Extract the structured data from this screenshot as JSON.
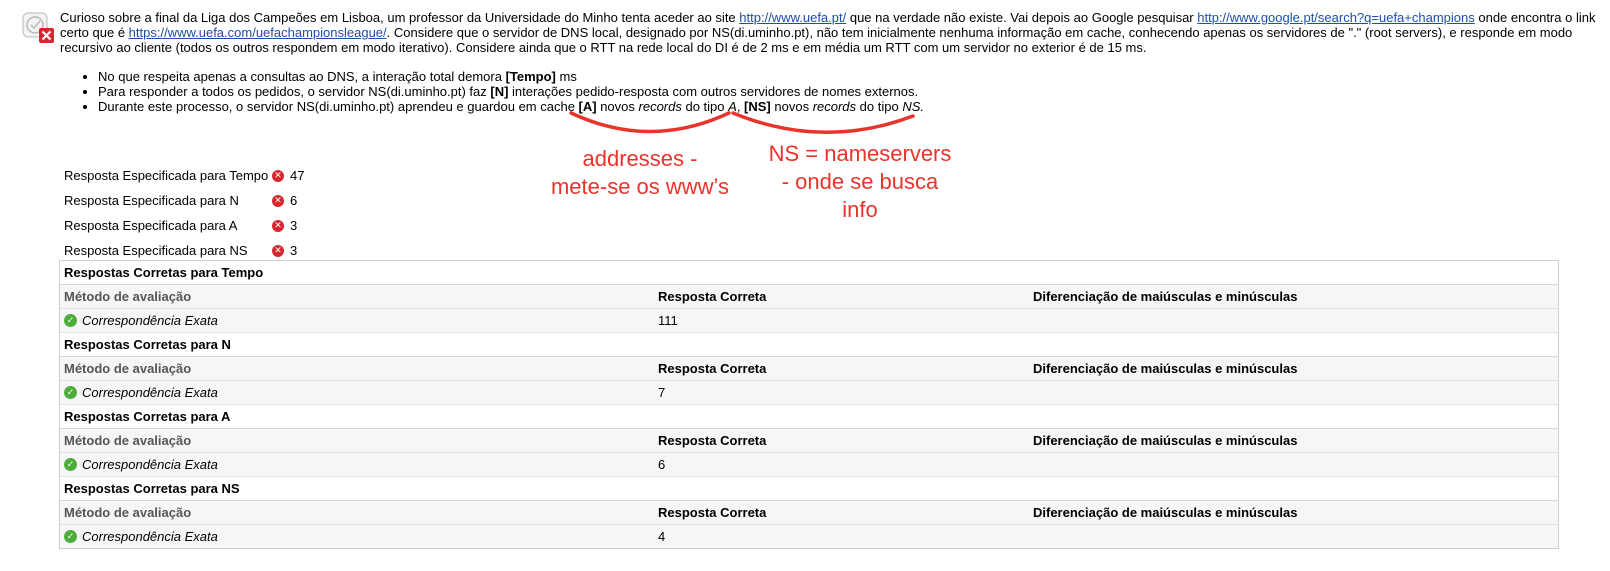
{
  "question": {
    "icon": "question-status-icon",
    "intro_1": "Curioso sobre a final da Liga dos Campeões em Lisboa, um professor da Universidade do Minho tenta aceder ao site ",
    "link_1": "http://www.uefa.pt/",
    "intro_2": " que na verdade não existe. Vai depois ao Google pesquisar ",
    "link_2": "http://www.google.pt/search?q=uefa+champions",
    "intro_3": " onde encontra o link certo que é ",
    "link_3": "https://www.uefa.com/uefachampionsleague/",
    "intro_4": ".  Considere que o servidor de DNS local, designado por NS(di.uminho.pt), não tem inicialmente nenhuma informação em cache, conhecendo apenas os servidores de \".\" (root servers), e responde em modo recursivo ao cliente (todos os outros respondem em modo iterativo). Considere ainda que o RTT na rede local do DI é de 2 ms e em média um RTT com um servidor no exterior é de 15 ms.",
    "b1_pre": "No que respeita apenas a consultas ao DNS, a interação total demora ",
    "b1_tag": "[Tempo]",
    "b1_post": " ms",
    "b2_pre": "Para responder a todos os pedidos, o servidor NS(di.uminho.pt) faz ",
    "b2_tag": "[N]",
    "b2_post": " interações pedido-resposta com outros servidores de nomes externos.",
    "b3_pre": "Durante este processo, o servidor NS(di.uminho.pt) aprendeu e guardou em cache ",
    "b3_tagA": "[A]",
    "b3_mid1": " novos ",
    "b3_rec1": "records",
    "b3_mid2": " do tipo ",
    "b3_typeA": "A",
    "b3_comma": ", ",
    "b3_tagNS": "[NS]",
    "b3_mid3": " novos ",
    "b3_rec2": "records",
    "b3_mid4": " do tipo ",
    "b3_typeNS": "NS."
  },
  "specified": [
    {
      "label": "Resposta Especificada para Tempo",
      "value": "47"
    },
    {
      "label": "Resposta Especificada para N",
      "value": "6"
    },
    {
      "label": "Resposta Especificada para A",
      "value": "3"
    },
    {
      "label": "Resposta Especificada para NS",
      "value": "3"
    }
  ],
  "wrong_mark": "✕",
  "ok_mark": "✓",
  "sections": [
    {
      "title": "Respostas Corretas para Tempo",
      "method": "Correspondência Exata",
      "answer": "111"
    },
    {
      "title": "Respostas Corretas para N",
      "method": "Correspondência Exata",
      "answer": "7"
    },
    {
      "title": "Respostas Corretas para A",
      "method": "Correspondência Exata",
      "answer": "6"
    },
    {
      "title": "Respostas Corretas para NS",
      "method": "Correspondência Exata",
      "answer": "4"
    }
  ],
  "columns": {
    "method": "Método de avaliação",
    "answer": "Resposta Correta",
    "case": "Diferenciação de maiúsculas e minúsculas"
  },
  "annotations": {
    "a_line1": "addresses -",
    "a_line2": "mete-se os www’s",
    "ns_line1": "NS = nameservers",
    "ns_line2": "- onde se busca",
    "ns_line3": "info",
    "color": "#e8342b"
  }
}
